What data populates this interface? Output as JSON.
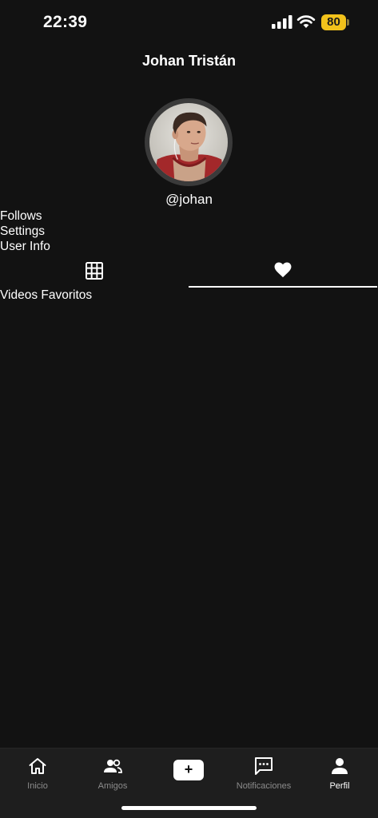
{
  "status_bar": {
    "time": "22:39",
    "battery": "80",
    "icons": [
      "signal-icon",
      "wifi-icon",
      "battery-icon"
    ]
  },
  "header": {
    "title": "Johan Tristán"
  },
  "profile": {
    "username": "@johan",
    "links": [
      "Follows",
      "Settings",
      "User Info"
    ]
  },
  "tabs": {
    "items": [
      {
        "icon": "grid-icon",
        "active": false
      },
      {
        "icon": "heart-icon",
        "active": true
      }
    ]
  },
  "section": {
    "title": "Videos Favoritos"
  },
  "bottom_nav": {
    "items": [
      {
        "label": "Inicio",
        "icon": "home-icon",
        "active": false
      },
      {
        "label": "Amigos",
        "icon": "friends-icon",
        "active": false
      },
      {
        "label": "+",
        "icon": "add-icon",
        "active": false
      },
      {
        "label": "Notificaciones",
        "icon": "chat-icon",
        "active": false
      },
      {
        "label": "Perfil",
        "icon": "person-icon",
        "active": true
      }
    ]
  },
  "colors": {
    "background": "#121212",
    "nav_background": "#1e1e1e",
    "battery": "#f2c21b",
    "inactive_label": "#8c8c8c",
    "text": "#ffffff"
  }
}
